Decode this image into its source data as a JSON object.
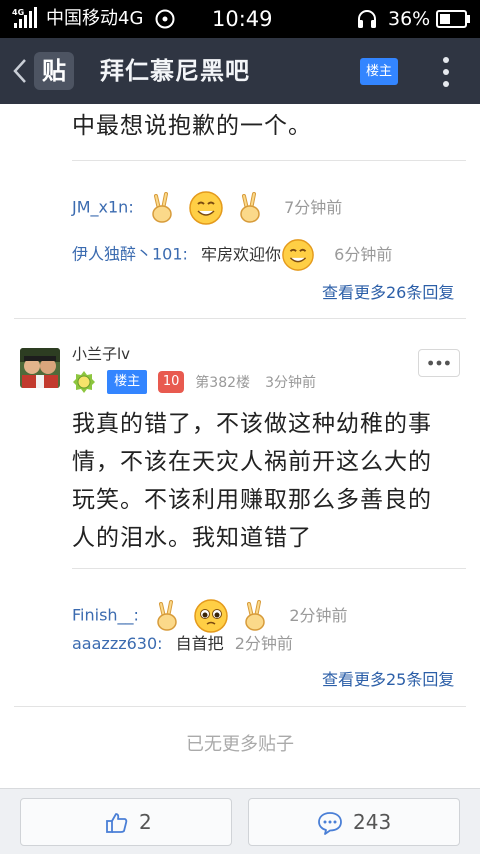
{
  "status_bar": {
    "network": "4G",
    "carrier": "中国移动4G",
    "time": "10:49",
    "battery": "36%"
  },
  "header": {
    "logo_char": "贴",
    "title": "拜仁慕尼黑吧",
    "owner_badge": "楼主"
  },
  "prev_post": {
    "body_tail": "中最想说抱歉的一个。",
    "replies": [
      {
        "user": "JM_x1n:",
        "time": "7分钟前",
        "emojis": [
          "victory",
          "smile",
          "victory"
        ]
      },
      {
        "user": "伊人独醉丶101:",
        "text": "牢房欢迎你",
        "emoji": "smile",
        "time": "6分钟前"
      }
    ],
    "more_replies": "查看更多26条回复"
  },
  "post": {
    "author": "小兰子lv",
    "owner_badge": "楼主",
    "level": "10",
    "floor": "第382楼",
    "time": "3分钟前",
    "lines": [
      "我真的错了，不该做这种幼稚的事",
      "情，不该在天灾人祸前开这么大的",
      "玩笑。不该利用赚取那么多善良的",
      "人的泪水。我知道错了"
    ],
    "replies": [
      {
        "user": "Finish__:",
        "time": "2分钟前",
        "emojis": [
          "victory",
          "teary",
          "victory"
        ]
      },
      {
        "user": "aaazzz630:",
        "text": "自首把",
        "time": "2分钟前"
      }
    ],
    "more_replies": "查看更多25条回复"
  },
  "footer_text": "已无更多贴子",
  "bottom_bar": {
    "likes": "2",
    "comments": "243"
  },
  "colors": {
    "header_bg": "#2f3542",
    "accent_blue": "#3385ff",
    "link_blue": "#2c5fa8",
    "level_red": "#e85a4f"
  }
}
